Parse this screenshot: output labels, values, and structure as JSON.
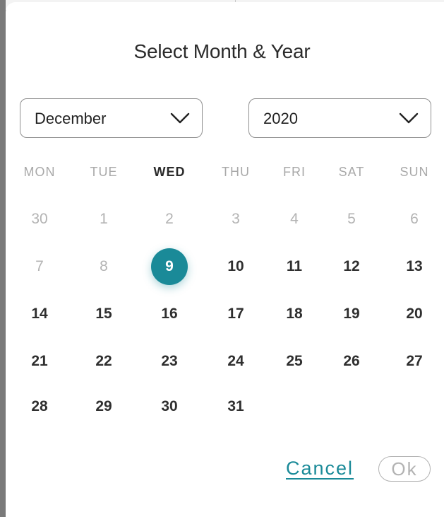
{
  "dialog": {
    "title": "Select Month & Year"
  },
  "month_select": {
    "value": "December",
    "icon": "chevron-down-icon"
  },
  "year_select": {
    "value": "2020",
    "icon": "chevron-down-icon"
  },
  "weekdays": [
    "MON",
    "TUE",
    "WED",
    "THU",
    "FRI",
    "SAT",
    "SUN"
  ],
  "active_weekday": "WED",
  "weeks": [
    [
      {
        "label": "30",
        "muted": true
      },
      {
        "label": "1",
        "muted": true
      },
      {
        "label": "2",
        "muted": true
      },
      {
        "label": "3",
        "muted": true
      },
      {
        "label": "4",
        "muted": true
      },
      {
        "label": "5",
        "muted": true
      },
      {
        "label": "6",
        "muted": true
      }
    ],
    [
      {
        "label": "7",
        "muted": true
      },
      {
        "label": "8",
        "muted": true
      },
      {
        "label": "9",
        "selected": true
      },
      {
        "label": "10"
      },
      {
        "label": "11"
      },
      {
        "label": "12"
      },
      {
        "label": "13"
      }
    ],
    [
      {
        "label": "14"
      },
      {
        "label": "15"
      },
      {
        "label": "16"
      },
      {
        "label": "17"
      },
      {
        "label": "18"
      },
      {
        "label": "19"
      },
      {
        "label": "20"
      }
    ],
    [
      {
        "label": "21"
      },
      {
        "label": "22"
      },
      {
        "label": "23"
      },
      {
        "label": "24"
      },
      {
        "label": "25"
      },
      {
        "label": "26"
      },
      {
        "label": "27"
      }
    ],
    [
      {
        "label": "28"
      },
      {
        "label": "29"
      },
      {
        "label": "30"
      },
      {
        "label": "31"
      }
    ]
  ],
  "actions": {
    "cancel_label": "Cancel",
    "ok_label": "Ok"
  },
  "colors": {
    "accent": "#1a8a98",
    "muted_text": "#b3b3b3",
    "primary_text": "#2f2f2f"
  }
}
